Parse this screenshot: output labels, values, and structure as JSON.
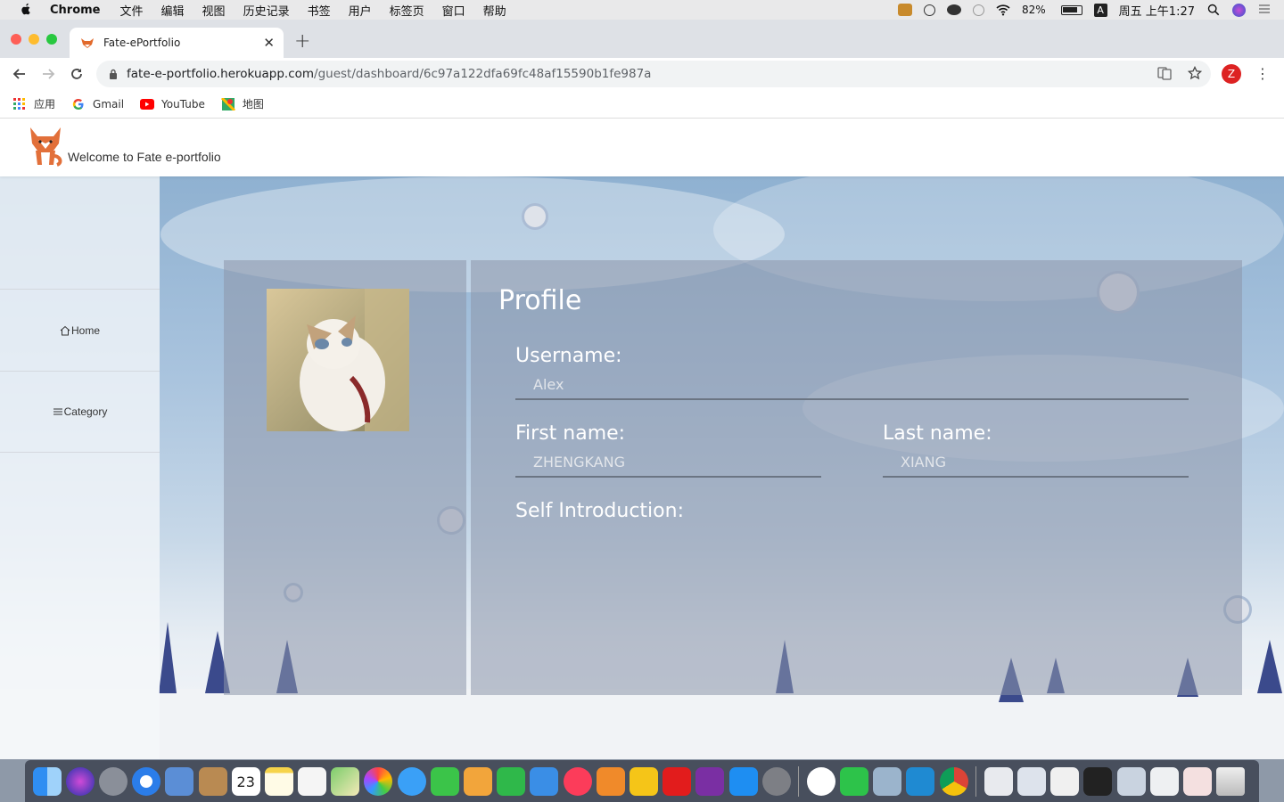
{
  "menubar": {
    "app": "Chrome",
    "items": [
      "文件",
      "编辑",
      "视图",
      "历史记录",
      "书签",
      "用户",
      "标签页",
      "窗口",
      "帮助"
    ],
    "battery": "82%",
    "input_method": "A",
    "datetime": "周五 上午1:27"
  },
  "browser": {
    "tab_title": "Fate-ePortfolio",
    "url_host": "fate-e-portfolio.herokuapp.com",
    "url_path": "/guest/dashboard/6c97a122dfa69fc48af15590b1fe987a",
    "profile_initial": "Z",
    "bookmarks": [
      {
        "label": "应用",
        "icon": "apps-grid-icon"
      },
      {
        "label": "Gmail",
        "icon": "google-icon"
      },
      {
        "label": "YouTube",
        "icon": "youtube-icon"
      },
      {
        "label": "地图",
        "icon": "maps-icon"
      }
    ]
  },
  "site": {
    "welcome": "Welcome to Fate e-portfolio",
    "sidebar": [
      {
        "label": "Home",
        "icon": "home-icon"
      },
      {
        "label": "Category",
        "icon": "menu-icon"
      }
    ]
  },
  "profile": {
    "title": "Profile",
    "username_label": "Username:",
    "username": "Alex",
    "first_name_label": "First name:",
    "first_name": "ZHENGKANG",
    "last_name_label": "Last name:",
    "last_name": "XIANG",
    "intro_label": "Self Introduction:"
  },
  "dock": {
    "calendar_day": "23"
  },
  "colors": {
    "panel": "#8c96aa",
    "tree": "#3b4a8c",
    "chrome_tab_strip": "#dee1e6"
  }
}
